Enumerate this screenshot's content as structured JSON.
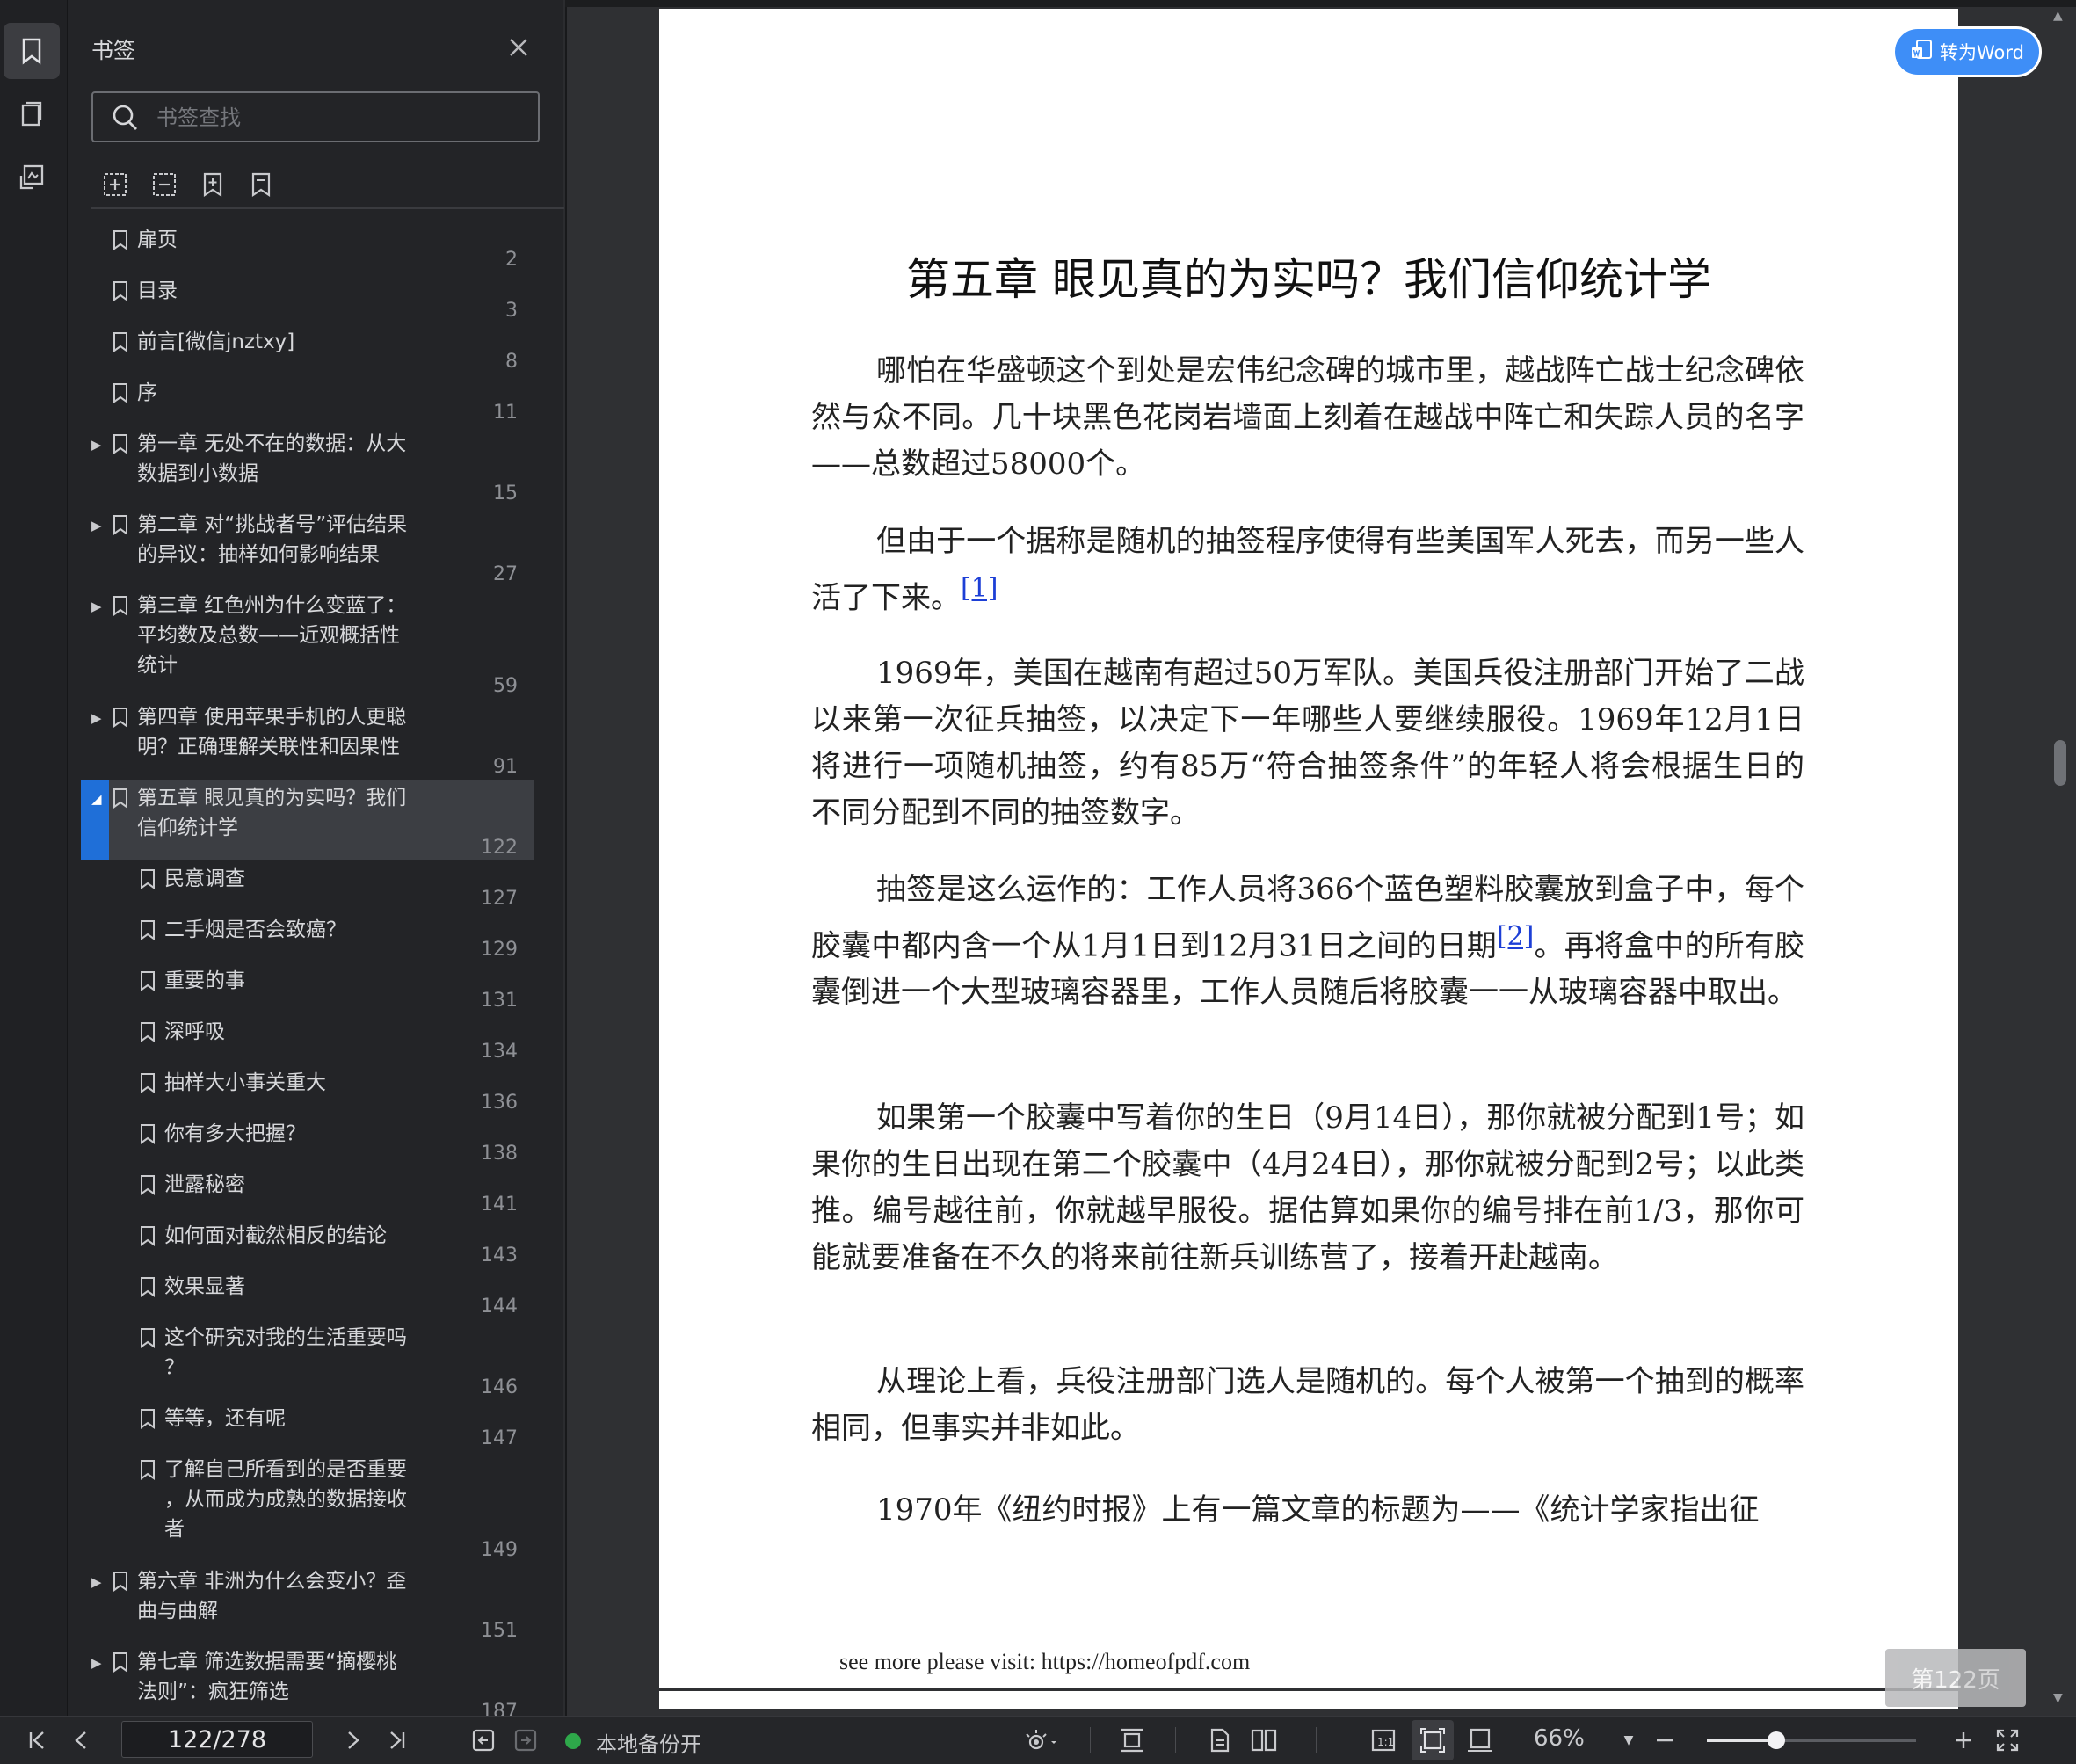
{
  "sidebar": {
    "title": "书签",
    "search_placeholder": "书签查找",
    "rail_icons": [
      "bookmark-icon",
      "thumbnail-icon",
      "annotation-icon"
    ],
    "tools": [
      "expand-all-icon",
      "collapse-all-icon",
      "add-bookmark-icon",
      "bookmark-list-icon"
    ],
    "items": [
      {
        "label": "扉页",
        "page": "2"
      },
      {
        "label": "目录",
        "page": "3"
      },
      {
        "label": "前言[微信jnztxy]",
        "page": "8"
      },
      {
        "label": "序",
        "page": "11"
      },
      {
        "label": "第一章 无处不在的数据：从大\n数据到小数据",
        "page": "15"
      },
      {
        "label": "第二章 对“挑战者号”评估结果\n的异议：抽样如何影响结果",
        "page": "27"
      },
      {
        "label": "第三章 红色州为什么变蓝了：\n平均数及总数——近观概括性\n统计",
        "page": "59"
      },
      {
        "label": "第四章 使用苹果手机的人更聪\n明？正确理解关联性和因果性",
        "page": "91"
      },
      {
        "label": "第五章 眼见真的为实吗？我们\n信仰统计学",
        "page": "122"
      },
      {
        "label": "民意调查",
        "page": "127"
      },
      {
        "label": "二手烟是否会致癌？",
        "page": "129"
      },
      {
        "label": "重要的事",
        "page": "131"
      },
      {
        "label": "深呼吸",
        "page": "134"
      },
      {
        "label": "抽样大小事关重大",
        "page": "136"
      },
      {
        "label": "你有多大把握？",
        "page": "138"
      },
      {
        "label": "泄露秘密",
        "page": "141"
      },
      {
        "label": "如何面对截然相反的结论",
        "page": "143"
      },
      {
        "label": "效果显著",
        "page": "144"
      },
      {
        "label": "这个研究对我的生活重要吗\n？",
        "page": "146"
      },
      {
        "label": "等等，还有呢",
        "page": "147"
      },
      {
        "label": "了解自己所看到的是否重要\n，从而成为成熟的数据接收\n者",
        "page": "149"
      },
      {
        "label": "第六章 非洲为什么会变小？歪\n曲与曲解",
        "page": "151"
      },
      {
        "label": "第七章 筛选数据需要“摘樱桃\n法则”：疯狂筛选",
        "page": "187"
      }
    ]
  },
  "document": {
    "title": "第五章 眼见真的为实吗？我们信仰统计学",
    "p1": "哪怕在华盛顿这个到处是宏伟纪念碑的城市里，越战阵亡战士纪念碑依然与众不同。几十块黑色花岗岩墙面上刻着在越战中阵亡和失踪人员的名字——总数超过58000个。",
    "p2a": "但由于一个据称是随机的抽签程序使得有些美国军人死去，而另一些人活了下来。",
    "fn1": "[1]",
    "p3": "1969年，美国在越南有超过50万军队。美国兵役注册部门开始了二战以来第一次征兵抽签，以决定下一年哪些人要继续服役。1969年12月1日将进行一项随机抽签，约有85万“符合抽签条件”的年轻人将会根据生日的不同分配到不同的抽签数字。",
    "p4a": "抽签是这么运作的：工作人员将366个蓝色塑料胶囊放到盒子中，每个胶囊中都内含一个从1月1日到12月31日之间的日期",
    "fn2": "[2]",
    "p4b": "。再将盒中的所有胶囊倒进一个大型玻璃容器里，工作人员随后将胶囊一一从玻璃容器中取出。",
    "p5": "如果第一个胶囊中写着你的生日（9月14日），那你就被分配到1号；如果你的生日出现在第二个胶囊中（4月24日），那你就被分配到2号；以此类推。编号越往前，你就越早服役。据估算如果你的编号排在前1/3，那你可能就要准备在不久的将来前往新兵训练营了，接着开赴越南。",
    "p6": "从理论上看，兵役注册部门选人是随机的。每个人被第一个抽到的概率相同，但事实并非如此。",
    "p7": "1970年《纽约时报》上有一篇文章的标题为——《统计学家指出征",
    "footer": "see more please visit: https://homeofpdf.com",
    "to_word": "转为Word",
    "page_badge": "第122页"
  },
  "toolbar": {
    "page_value": "122/278",
    "backup_label": "本地备份开",
    "zoom_label": "66%",
    "zoom_fraction": 0.33,
    "accent": "#1f6fd8",
    "button_blue": "#3e8ef7"
  }
}
